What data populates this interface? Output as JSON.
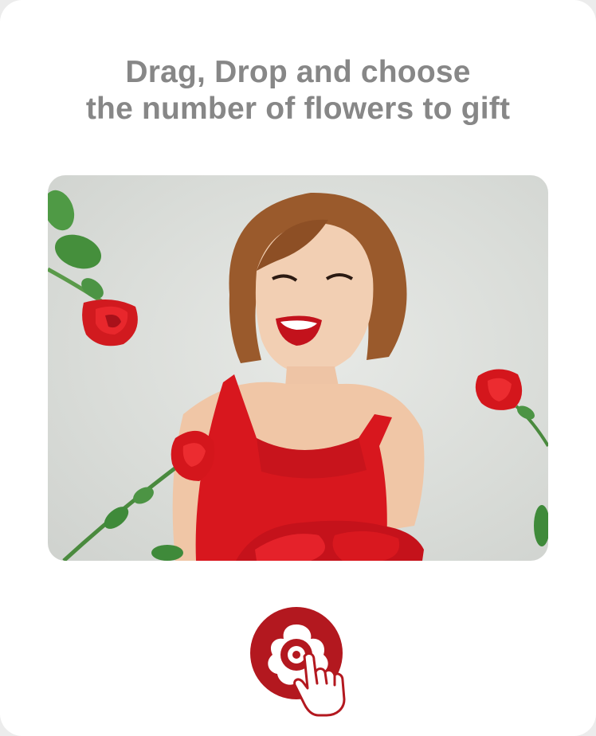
{
  "headline": {
    "line1": "Drag, Drop and choose",
    "line2": "the number of flowers to gift"
  },
  "photo": {
    "subject": "smiling-woman-red-dress-with-roses-image"
  },
  "cta": {
    "icon": "flower-tap-icon",
    "color": "#b3181f"
  },
  "colors": {
    "headline_text": "#878787",
    "rose_red": "#d4161c",
    "leaf_green": "#3f8a3a",
    "background": "#ffffff"
  }
}
